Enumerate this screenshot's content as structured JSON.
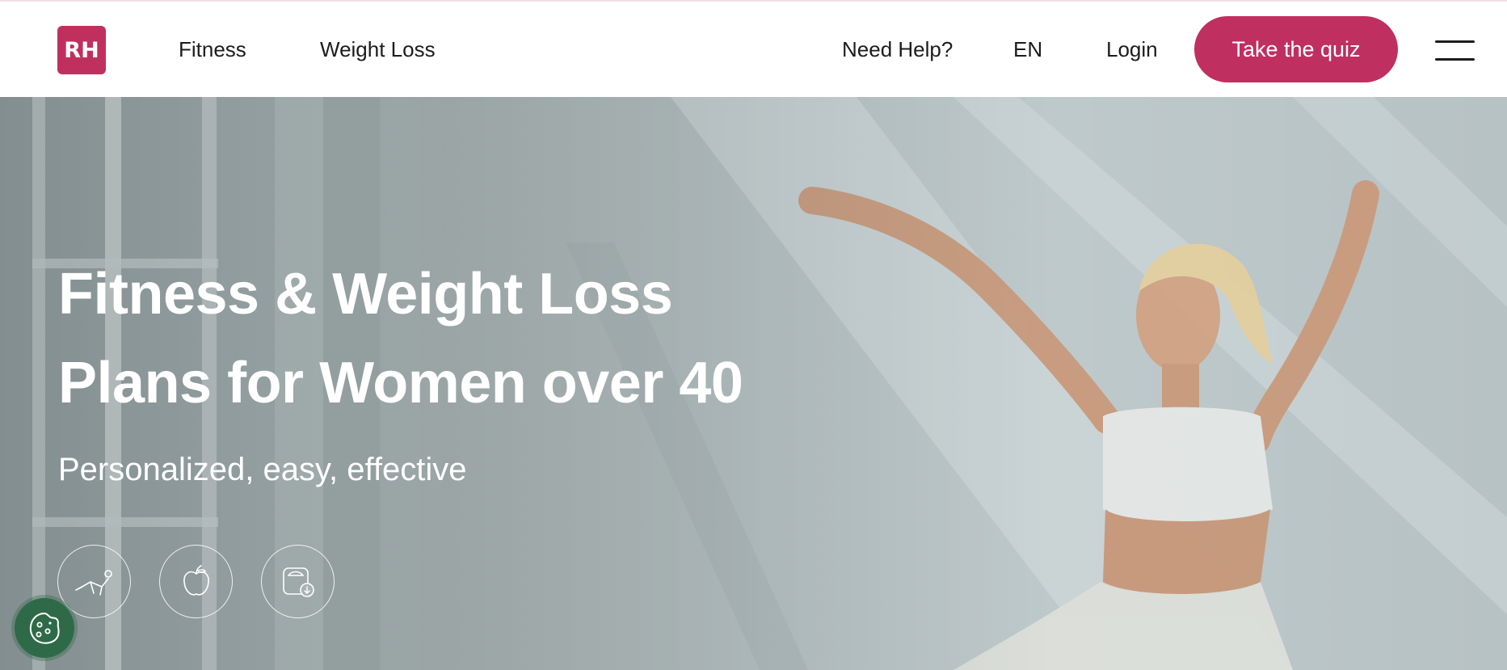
{
  "brand": {
    "logo_text": "RH",
    "accent_color": "#bf2f5f"
  },
  "nav": {
    "left_links": [
      "Fitness",
      "Weight Loss"
    ],
    "help_label": "Need Help?",
    "language_label": "EN",
    "login_label": "Login",
    "cta_label": "Take the quiz",
    "menu_icon": "hamburger-menu-icon"
  },
  "hero": {
    "title_line1": "Fitness & Weight Loss",
    "title_line2": "Plans for Women over 40",
    "subtitle": "Personalized, easy, effective",
    "features": [
      {
        "icon": "exercise-icon"
      },
      {
        "icon": "apple-icon"
      },
      {
        "icon": "scale-icon"
      }
    ]
  },
  "cookie_widget": {
    "icon": "cookie-icon",
    "color": "#2f6a48"
  }
}
